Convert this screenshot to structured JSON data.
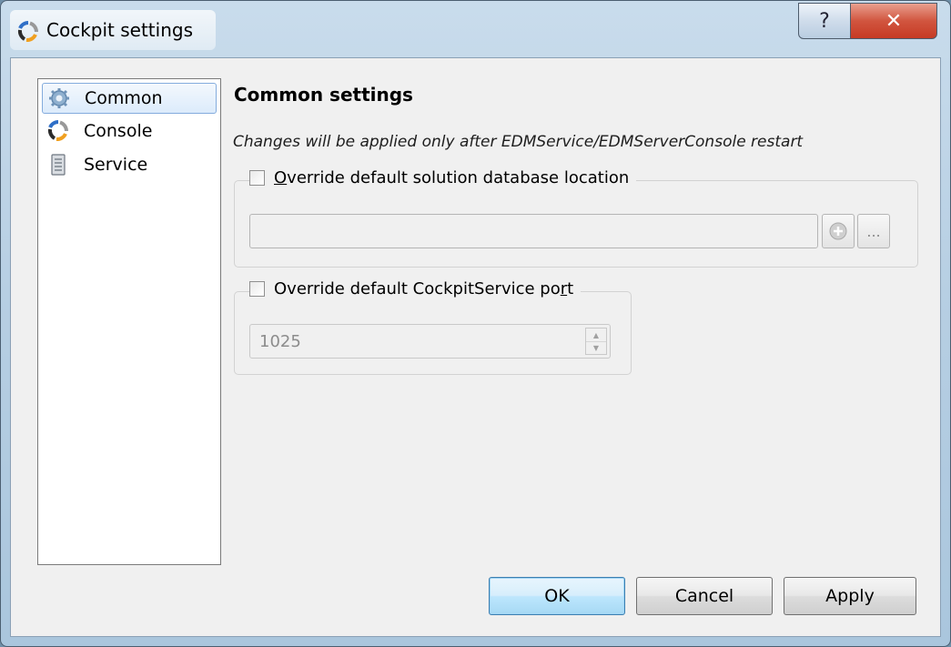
{
  "window": {
    "title": "Cockpit settings",
    "help_glyph": "?",
    "close_glyph": "✕"
  },
  "sidebar": {
    "items": [
      {
        "label": "Common",
        "icon": "gear-icon",
        "selected": true
      },
      {
        "label": "Console",
        "icon": "cockpit-icon",
        "selected": false
      },
      {
        "label": "Service",
        "icon": "document-icon",
        "selected": false
      }
    ]
  },
  "main": {
    "section_title": "Common settings",
    "note": "Changes will be applied only after EDMService/EDMServerConsole restart",
    "db_location": {
      "checkbox_label_pre": "",
      "checkbox_label_accel": "O",
      "checkbox_label_post": "verride default solution database location",
      "checked": false,
      "path_value": "",
      "browse_label": "..."
    },
    "service_port": {
      "checkbox_label_pre": "Override default CockpitService po",
      "checkbox_label_accel": "r",
      "checkbox_label_post": "t",
      "checked": false,
      "port_value": "1025"
    }
  },
  "buttons": {
    "ok": "OK",
    "cancel": "Cancel",
    "apply": "Apply"
  },
  "colors": {
    "title_bar": "#b7cfe3",
    "close_button": "#c63a24",
    "default_button_border": "#3c7fb1",
    "selection_border": "#84acdd"
  }
}
